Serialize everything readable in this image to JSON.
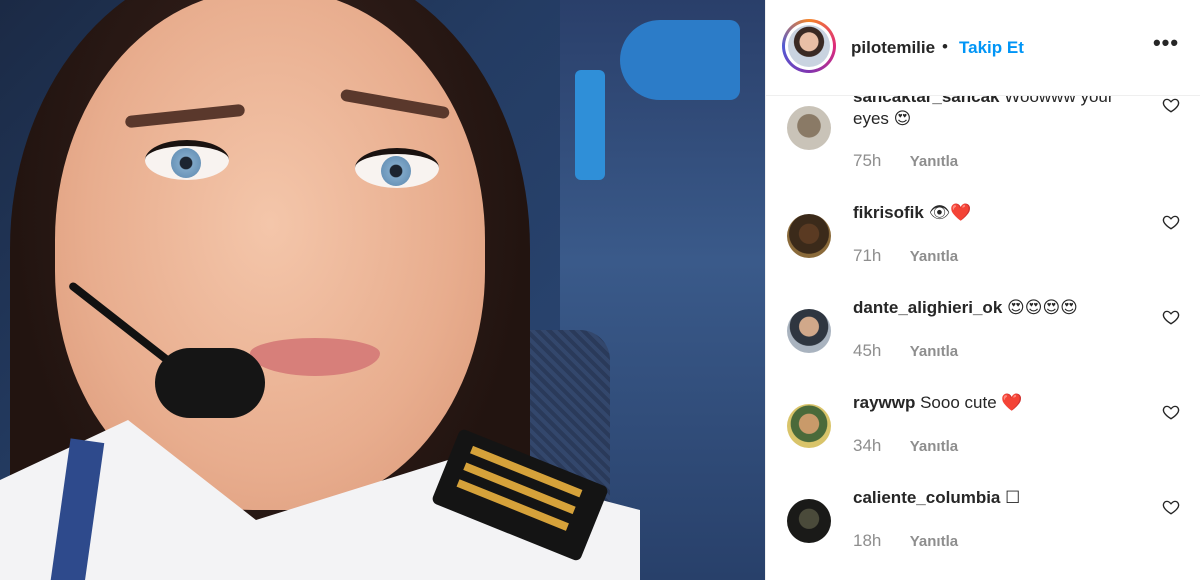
{
  "post": {
    "username": "pilotemilie",
    "separator": "•",
    "follow_label": "Takip Et",
    "more_label": "•••"
  },
  "colors": {
    "accent_blue": "#0095f6",
    "text_primary": "#262626",
    "text_secondary": "#8e8e8e"
  },
  "comments": [
    {
      "username": "sancaktar_sancak",
      "text": "Woowww your eyes",
      "emoji": "😍",
      "time": "75h",
      "reply_label": "Yanıtla"
    },
    {
      "username": "fikrisofik",
      "text": "",
      "emoji": "👁❤️",
      "time": "71h",
      "reply_label": "Yanıtla"
    },
    {
      "username": "dante_alighieri_ok",
      "text": "",
      "emoji": "😍😍😍😍",
      "time": "45h",
      "reply_label": "Yanıtla"
    },
    {
      "username": "raywwp",
      "text": "Sooo cute",
      "emoji": "❤️",
      "time": "34h",
      "reply_label": "Yanıtla"
    },
    {
      "username": "caliente_columbia",
      "text": "",
      "emoji": "☐",
      "time": "18h",
      "reply_label": "Yanıtla"
    }
  ],
  "icons": {
    "like": "heart-outline-icon",
    "more": "more-options-icon"
  }
}
